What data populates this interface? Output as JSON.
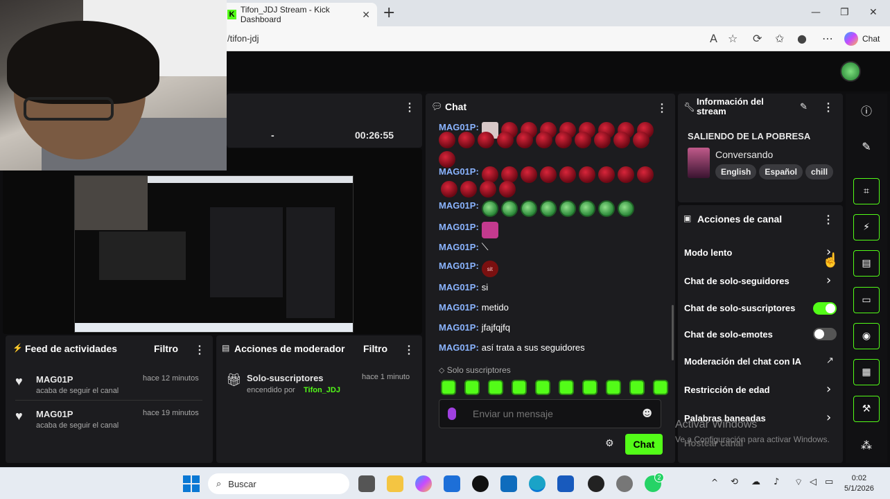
{
  "browser": {
    "tab_title": "Tifon_JDJ Stream - Kick Dashboard",
    "url": "/tifon-jdj",
    "copilot_label": "Chat"
  },
  "stats": {
    "dash": "-",
    "duration": "00:26:55"
  },
  "feed": {
    "title": "Feed de actividades",
    "filter": "Filtro",
    "items": [
      {
        "user": "MAG01P",
        "action": "acaba de seguir el canal",
        "time": "hace 12 minutos"
      },
      {
        "user": "MAG01P",
        "action": "acaba de seguir el canal",
        "time": "hace 19 minutos"
      }
    ]
  },
  "mod": {
    "title": "Acciones de moderador",
    "filter": "Filtro",
    "item_title": "Solo-suscriptores",
    "item_prefix": "encendido por",
    "item_user": "Tifon_JDJ",
    "item_time": "hace 1 minuto"
  },
  "chat": {
    "title": "Chat",
    "messages": [
      {
        "user": "MAG01P:",
        "text": ""
      },
      {
        "user": "MAG01P:",
        "text": ""
      },
      {
        "user": "MAG01P:",
        "text": ""
      },
      {
        "user": "MAG01P:",
        "text": ""
      },
      {
        "user": "MAG01P:",
        "text": ""
      },
      {
        "user": "MAG01P:",
        "text": ""
      },
      {
        "user": "MAG01P:",
        "text": "si"
      },
      {
        "user": "MAG01P:",
        "text": "metido"
      },
      {
        "user": "MAG01P:",
        "text": "jfajfqjfq"
      },
      {
        "user": "MAG01P:",
        "text": "así trata a sus seguidores"
      }
    ],
    "subs_label": "Solo suscriptores",
    "input_placeholder": "Enviar un mensaje",
    "send_label": "Chat"
  },
  "info": {
    "title": "Información del stream",
    "stream_title": "SALIENDO DE LA POBRESA",
    "category": "Conversando",
    "tags": [
      "English",
      "Español",
      "chill"
    ]
  },
  "actions": {
    "title": "Acciones de canal",
    "items": [
      {
        "label": "Modo lento",
        "control": "chevron"
      },
      {
        "label": "Chat de solo-seguidores",
        "control": "chevron"
      },
      {
        "label": "Chat de solo-suscriptores",
        "control": "toggle-on"
      },
      {
        "label": "Chat de solo-emotes",
        "control": "toggle-off"
      },
      {
        "label": "Moderación del chat con IA",
        "control": "external"
      },
      {
        "label": "Restricción de edad",
        "control": "chevron"
      },
      {
        "label": "Palabras baneadas",
        "control": "chevron"
      },
      {
        "label": "Hostear canal",
        "control": "none"
      }
    ]
  },
  "watermark": {
    "line1": "Activar Windows",
    "line2": "Ve a Configuración para activar Windows."
  },
  "taskbar": {
    "search": "Buscar",
    "time": "0:02",
    "date": "5/1/2026",
    "whatsapp_badge": "2"
  },
  "colors": {
    "accent": "#53fc18",
    "panel": "#1c1c1f",
    "username": "#8ab4ff"
  }
}
